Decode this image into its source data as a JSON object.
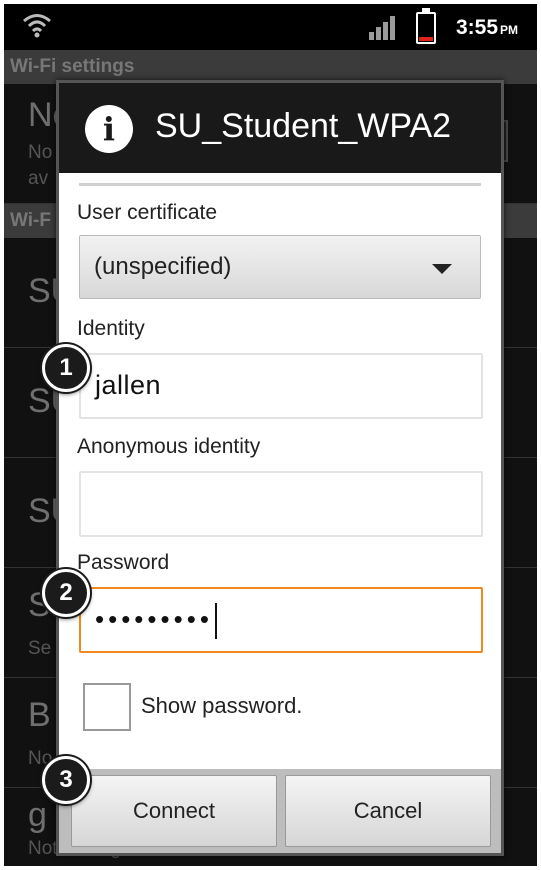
{
  "status_bar": {
    "time": "3:55",
    "ampm": "PM",
    "wifi_icon": "wifi-icon",
    "signal_icon": "signal-icon",
    "battery_icon": "battery-icon",
    "battery_color": "#e0241b"
  },
  "background": {
    "header_wifi_settings": "Wi-Fi settings",
    "network_notification": {
      "title": "Ne",
      "subtitle_line1": "No",
      "subtitle_line2": "av"
    },
    "header_wifi_networks": "Wi-F",
    "rows": [
      {
        "title": "SU",
        "subtitle": ""
      },
      {
        "title": "SU",
        "subtitle": ""
      },
      {
        "title": "SU",
        "subtitle": ""
      },
      {
        "title": "SU",
        "subtitle": "Se"
      },
      {
        "title": "B",
        "subtitle": "No"
      },
      {
        "title": "g",
        "subtitle": "Not in range"
      }
    ]
  },
  "dialog": {
    "title": "SU_Student_WPA2",
    "user_certificate_label": "User certificate",
    "user_certificate_value": "(unspecified)",
    "identity_label": "Identity",
    "identity_value": "jallen",
    "anonymous_identity_label": "Anonymous identity",
    "anonymous_identity_value": "",
    "password_label": "Password",
    "password_value": "•••••••••",
    "show_password_label": "Show password.",
    "connect_label": "Connect",
    "cancel_label": "Cancel",
    "focus_color": "#f08a1c"
  },
  "markers": [
    "1",
    "2",
    "3"
  ]
}
